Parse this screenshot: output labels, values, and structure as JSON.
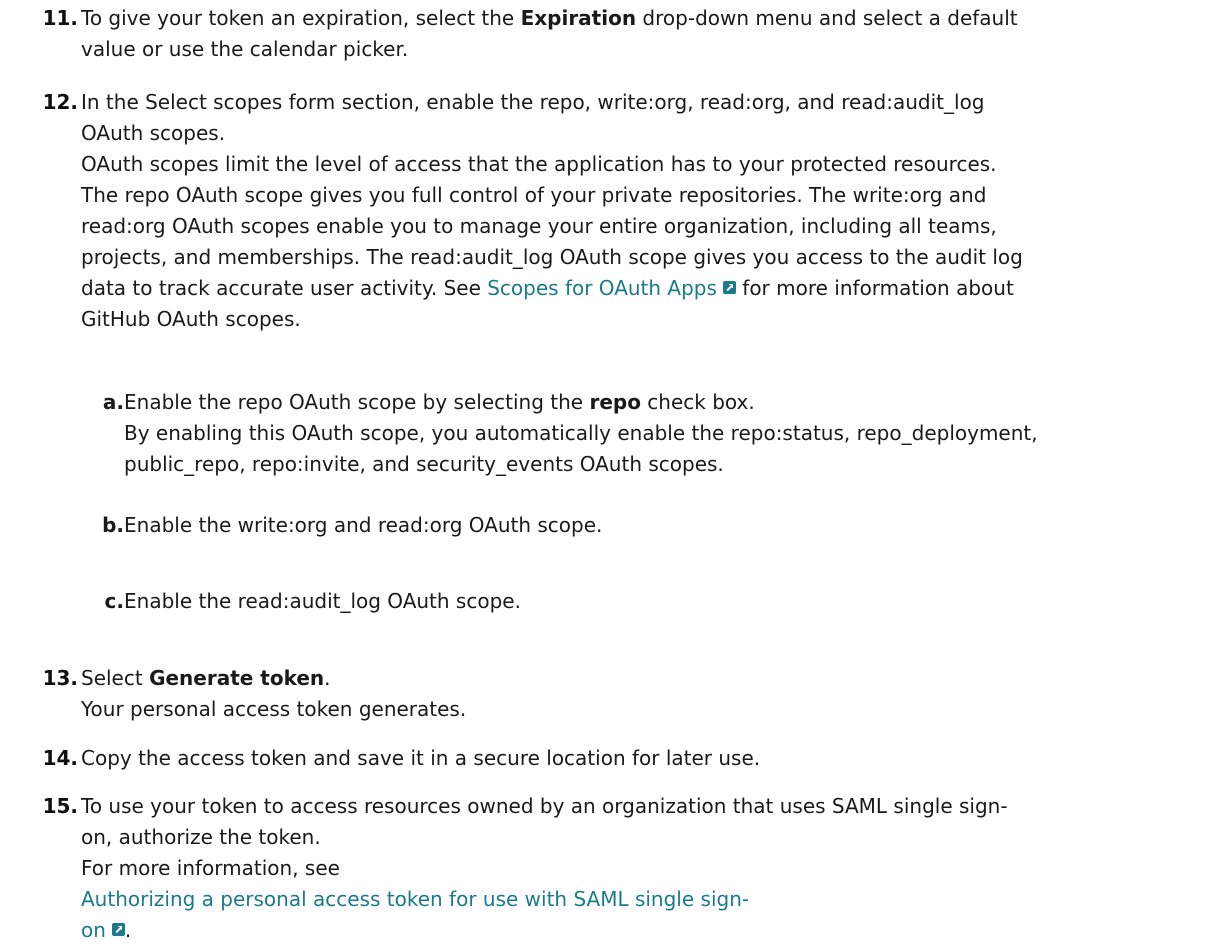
{
  "steps": {
    "s11": {
      "number": "11.",
      "pre": "To give your token an expiration, select the ",
      "bold": "Expiration",
      "post1": " drop-down menu and select a default",
      "post2": "value or use the calendar picker."
    },
    "s12": {
      "number": "12.",
      "line1": "In the Select scopes form section, enable the repo, write:org, read:org, and read:audit_log",
      "line2": "OAuth scopes.",
      "p1": "OAuth scopes limit the level of access that the application has to your protected resources.",
      "p2": "The repo OAuth scope gives you full control of your private repositories. The write:org and",
      "p3": "read:org OAuth scopes enable you to manage your entire organization, including all teams,",
      "p4": "projects, and memberships. The read:audit_log OAuth scope gives you access to the audit log",
      "p5_pre": "data to track accurate user activity. See ",
      "p5_link": "Scopes for OAuth Apps",
      "p5_post": " for more information about",
      "p6": "GitHub OAuth scopes.",
      "a": {
        "label": "a.",
        "pre": "Enable the repo OAuth scope by selecting the ",
        "bold": "repo",
        "post": " check box.",
        "l2": "By enabling this OAuth scope, you automatically enable the repo:status, repo_deployment,",
        "l3": "public_repo, repo:invite, and security_events OAuth scopes."
      },
      "b": {
        "label": "b.",
        "text": "Enable the write:org and read:org OAuth scope."
      },
      "c": {
        "label": "c.",
        "text": "Enable the read:audit_log OAuth scope."
      }
    },
    "s13": {
      "number": "13.",
      "pre": "Select ",
      "bold": "Generate token",
      "post": ".",
      "l2": "Your personal access token generates."
    },
    "s14": {
      "number": "14.",
      "text": "Copy the access token and save it in a secure location for later use."
    },
    "s15": {
      "number": "15.",
      "l1": "To use your token to access resources owned by an organization that uses SAML single sign-",
      "l2": "on, authorize the token.",
      "l3": "For more information, see ",
      "link1": "Authorizing a personal access token for use with SAML single sign-",
      "link2": "on",
      "post": "."
    }
  },
  "icons": {
    "external_link": "external-link-icon"
  },
  "colors": {
    "text": "#1a1a1a",
    "link": "#1a7a8e"
  }
}
